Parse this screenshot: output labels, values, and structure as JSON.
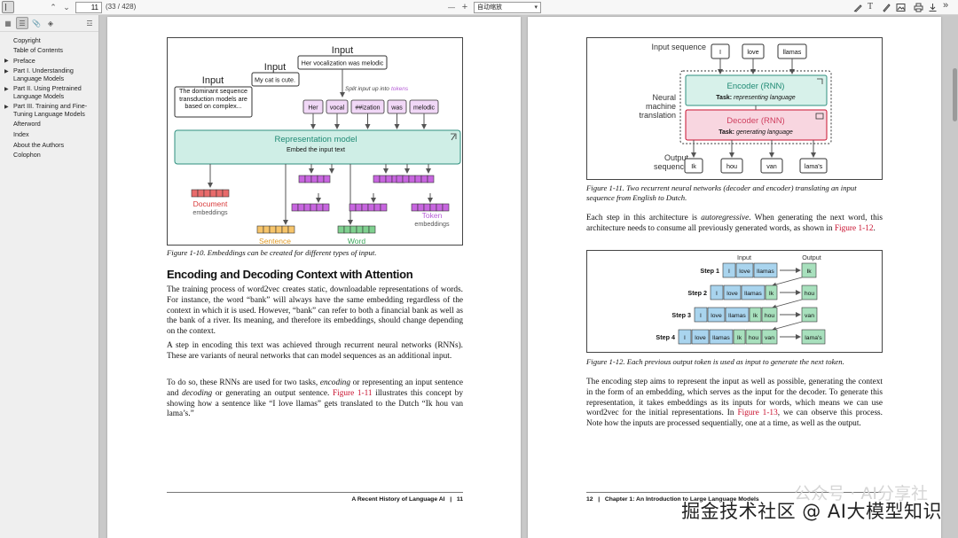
{
  "toolbar": {
    "page_number": "11",
    "page_count": "(33 / 428)",
    "zoom_value": "自动缩放",
    "zoom_out": "—",
    "zoom_in": "+"
  },
  "sidebar": {
    "items": [
      {
        "label": "Copyright",
        "expandable": false
      },
      {
        "label": "Table of Contents",
        "expandable": false
      },
      {
        "label": "Preface",
        "expandable": true
      },
      {
        "label": "Part I. Understanding Language Models",
        "expandable": true
      },
      {
        "label": "Part II. Using Pretrained Language Models",
        "expandable": true
      },
      {
        "label": "Part III. Training and Fine-Tuning Language Models",
        "expandable": true
      },
      {
        "label": "Afterword",
        "expandable": false
      },
      {
        "label": "Index",
        "expandable": false
      },
      {
        "label": "About the Authors",
        "expandable": false
      },
      {
        "label": "Colophon",
        "expandable": false
      }
    ]
  },
  "left_page": {
    "fig10": {
      "input_label": "Input",
      "input_text_1": "The dominant sequence transduction models are based on complex...",
      "input_text_2": "My cat is cute.",
      "input_text_3": "Her vocalization was melodic",
      "split_note": "Split input up into",
      "split_note_tokens": "tokens",
      "tokens": [
        "Her",
        "vocal",
        "##ization",
        "was",
        "melodic"
      ],
      "model_title": "Representation model",
      "model_sub": "Embed the input text",
      "doc_label": "Document",
      "sentence_label": "Sentence",
      "word_label": "Word",
      "token_label": "Token",
      "embeddings": "embeddings"
    },
    "fig10_caption": "Figure 1-10. Embeddings can be created for different types of input.",
    "heading": "Encoding and Decoding Context with Attention",
    "p1": "The training process of word2vec creates static, downloadable representations of words. For instance, the word “bank” will always have the same embedding regardless of the context in which it is used. However, “bank” can refer to both a financial bank as well as the bank of a river. Its meaning, and therefore its embeddings, should change depending on the context.",
    "p2": "A step in encoding this text was achieved through recurrent neural networks (RNNs). These are variants of neural networks that can model sequences as an additional input.",
    "p3_a": "To do so, these RNNs are used for two tasks,",
    "p3_encoding": "encoding",
    "p3_b": "or representing an input sentence and",
    "p3_decoding": "decoding",
    "p3_c": "or generating an output sentence.",
    "p3_link": "Figure 1-11",
    "p3_d": "illustrates this concept by showing how a sentence like “I love llamas” gets translated to the Dutch “Ik hou van lama’s.”",
    "footer_title": "A Recent History of Language AI",
    "footer_sep": "|",
    "footer_page": "11"
  },
  "right_page": {
    "fig11": {
      "input_sequence": "Input sequence",
      "input_tokens": [
        "I",
        "love",
        "llamas"
      ],
      "nmt_label": "Neural machine translation",
      "encoder_title": "Encoder (RNN)",
      "encoder_task_prefix": "Task:",
      "encoder_task": "representing language",
      "decoder_title": "Decoder (RNN)",
      "decoder_task_prefix": "Task:",
      "decoder_task": "generating language",
      "output_sequence": "Output sequence",
      "output_tokens": [
        "Ik",
        "hou",
        "van",
        "lama's"
      ]
    },
    "fig11_caption": "Figure 1-11. Two recurrent neural networks (decoder and encoder) translating an input sequence from English to Dutch.",
    "p1_a": "Each step in this architecture is",
    "p1_auto": "autoregressive",
    "p1_b": ". When generating the next word, this architecture needs to consume all previously generated words, as shown in",
    "p1_link": "Figure 1-12",
    "p1_c": ".",
    "fig12": {
      "input_label": "Input",
      "output_label": "Output",
      "steps": [
        {
          "label": "Step 1",
          "inputs": [
            "I",
            "love",
            "llamas"
          ],
          "gen": [],
          "output": "Ik"
        },
        {
          "label": "Step 2",
          "inputs": [
            "I",
            "love",
            "llamas"
          ],
          "gen": [
            "Ik"
          ],
          "output": "hou"
        },
        {
          "label": "Step 3",
          "inputs": [
            "I",
            "love",
            "llamas"
          ],
          "gen": [
            "Ik",
            "hou"
          ],
          "output": "van"
        },
        {
          "label": "Step 4",
          "inputs": [
            "I",
            "love",
            "llamas"
          ],
          "gen": [
            "Ik",
            "hou",
            "van"
          ],
          "output": "lama's"
        }
      ]
    },
    "fig12_caption": "Figure 1-12. Each previous output token is used as input to generate the next token.",
    "p2_a": "The encoding step aims to represent the input as well as possible, generating the context in the form of an embedding, which serves as the input for the decoder. To generate this representation, it takes embeddings as its inputs for words, which means we can use word2vec for the initial representations. In",
    "p2_link": "Figure 1-13",
    "p2_b": ", we can observe this process. Note how the inputs are processed sequentially, one at a time, as well as the output.",
    "footer_page": "12",
    "footer_sep": "|",
    "footer_title": "Chapter 1: An Introduction to Large Language Models"
  },
  "watermark": "掘金技术社区 @ AI大模型知识",
  "watermark_faint": "公众号 · AI分享社",
  "colors": {
    "teal": "#cfeee6",
    "teal_border": "#2f8f7f",
    "encoder_fill": "#d7f1ea",
    "decoder_fill": "#f8d6e0",
    "red": "#c8102e",
    "purple": "#c765df",
    "orange": "#f6c46a",
    "green": "#7fd08f",
    "blue": "#a9d4ee",
    "token_violet": "#b55cd6",
    "doc_red": "#e86b6b"
  }
}
